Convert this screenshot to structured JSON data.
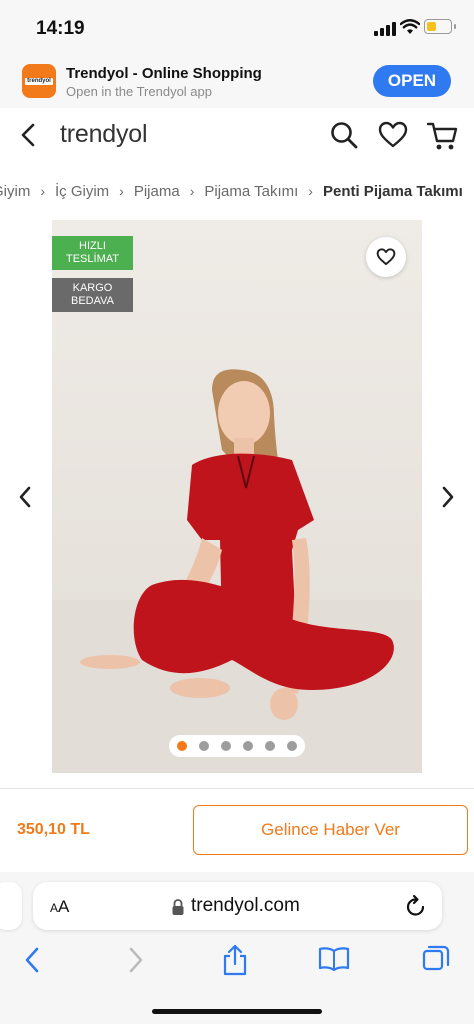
{
  "status": {
    "time": "14:19",
    "battery_color": "#f4c21c"
  },
  "banner": {
    "app_icon_text": "trendyol",
    "title": "Trendyol - Online Shopping",
    "subtitle": "Open in the Trendyol app",
    "open_label": "OPEN"
  },
  "header": {
    "logo": "trendyol"
  },
  "breadcrumb": {
    "items": [
      "Giyim",
      "İç Giyim",
      "Pijama",
      "Pijama Takımı",
      "Penti Pijama Takımı"
    ]
  },
  "product": {
    "badges": {
      "fast_line1": "HIZLI",
      "fast_line2": "TESLİMAT",
      "cargo_line1": "KARGO",
      "cargo_line2": "BEDAVA"
    },
    "gallery": {
      "image_count": 6,
      "active_index": 0
    },
    "price": "350,10 TL",
    "notify_label": "Gelince Haber Ver"
  },
  "safari": {
    "aa_big": "A",
    "aa_small": "A",
    "url": "trendyol.com"
  },
  "colors": {
    "brand": "#f27a1a",
    "fast_badge": "#4caf50",
    "cargo_badge": "#6a6a6a",
    "open_button": "#2f7af0"
  },
  "icons": [
    "back-icon",
    "search-icon",
    "heart-icon",
    "cart-icon",
    "chevron-left-icon",
    "chevron-right-icon",
    "lock-icon",
    "reload-icon",
    "share-icon",
    "bookmarks-icon",
    "tabs-icon"
  ]
}
